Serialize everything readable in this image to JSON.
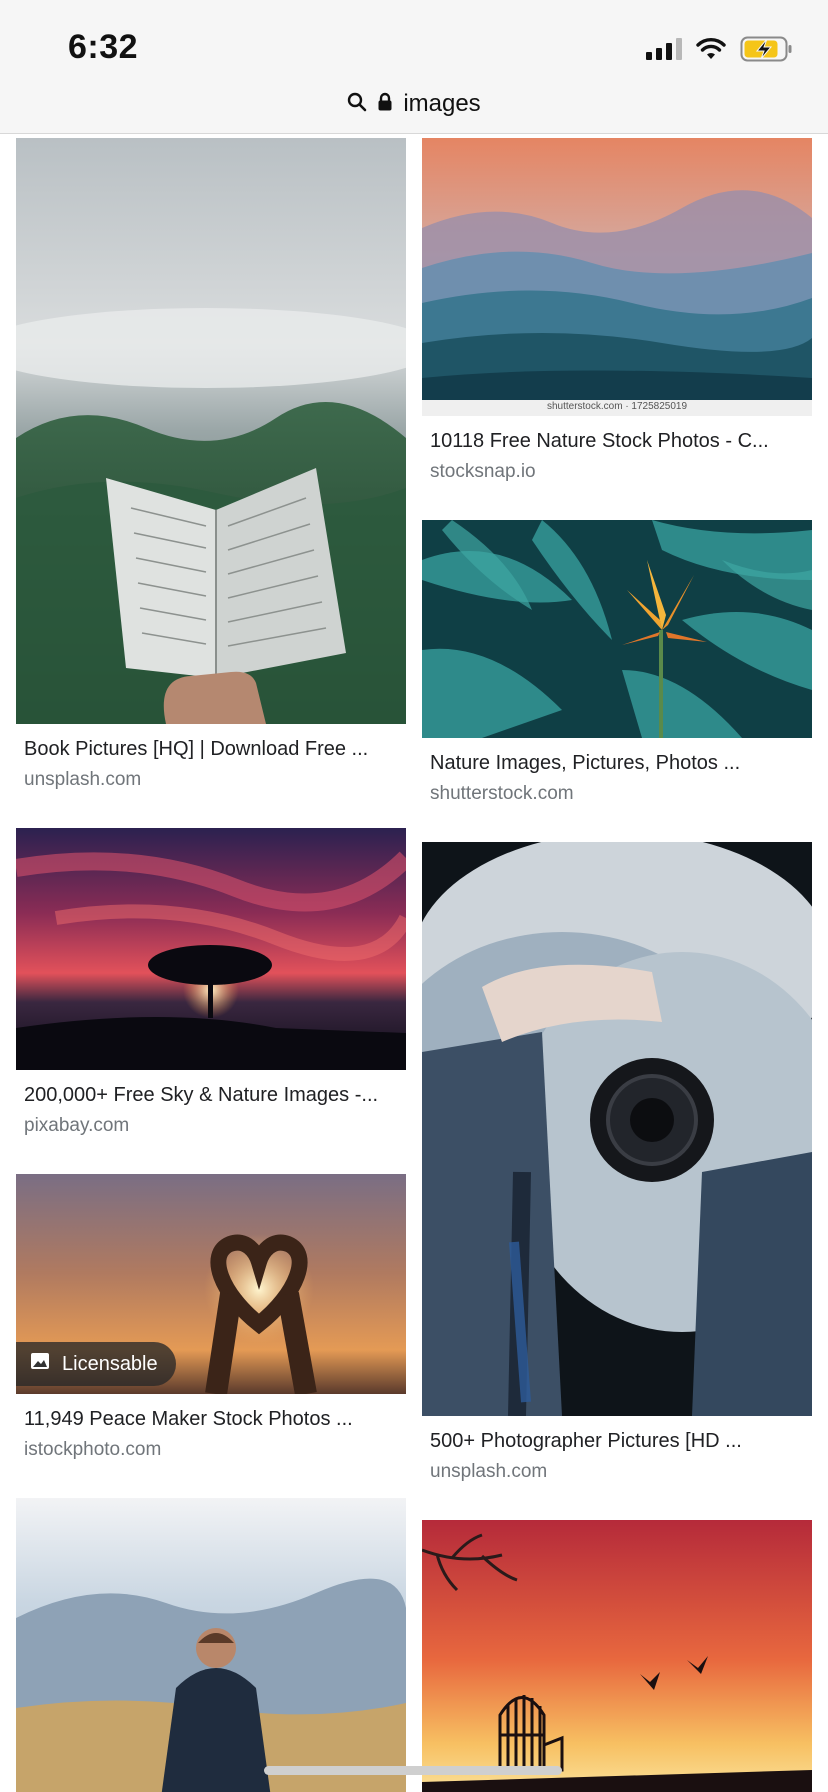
{
  "status_bar": {
    "time": "6:32",
    "signal_icon": "cellular-signal-icon",
    "wifi_icon": "wifi-icon",
    "battery_icon": "battery-charging-icon"
  },
  "url_bar": {
    "search_icon": "search-icon",
    "lock_icon": "lock-icon",
    "text": "images"
  },
  "results": {
    "left": [
      {
        "title": "Book Pictures [HQ] | Download Free ...",
        "source": "unsplash.com",
        "image": "open book held over misty forest"
      },
      {
        "title": "200,000+ Free Sky & Nature Images -...",
        "source": "pixabay.com",
        "image": "lone tree silhouette at red sunset over sea"
      },
      {
        "title": "11,949 Peace Maker Stock Photos ...",
        "source": "istockphoto.com",
        "badge": "Licensable",
        "image": "hands forming heart against sunset sky"
      },
      {
        "title": "",
        "source": "",
        "image": "man in jacket facing mountains in field"
      }
    ],
    "right": [
      {
        "title": "10118 Free Nature Stock Photos - C...",
        "source": "stocksnap.io",
        "watermark": "shutterstock.com · 1725825019",
        "image": "layered blue misty mountains at dusk"
      },
      {
        "title": "Nature Images, Pictures, Photos ...",
        "source": "shutterstock.com",
        "image": "orange bird of paradise flower on teal leaves"
      },
      {
        "title": "500+ Photographer Pictures [HD ...",
        "source": "unsplash.com",
        "image": "hand holding camera in front of smoke"
      },
      {
        "title": "",
        "source": "",
        "image": "birdcage and birds silhouetted at sunset"
      }
    ]
  },
  "colors": {
    "title_text": "#202124",
    "source_text": "#70757a",
    "bar_bg": "#f6f6f6"
  }
}
